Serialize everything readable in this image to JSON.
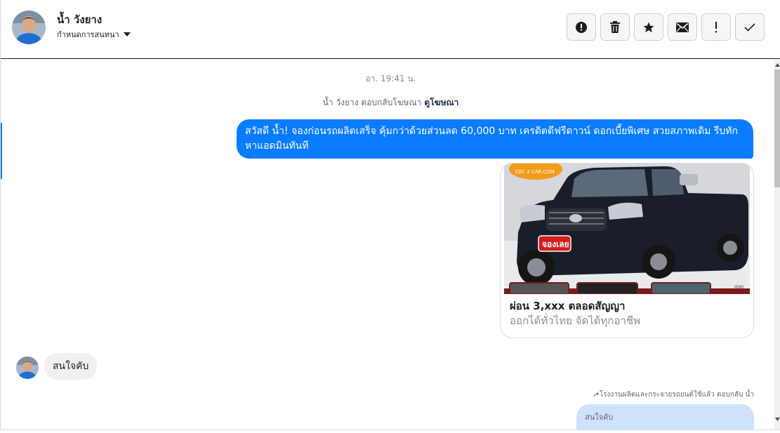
{
  "header": {
    "contact_name": "น้ำ วังยาง",
    "assign_label": "กำหนดการสนทนา",
    "actions": [
      "report",
      "delete",
      "star",
      "mail",
      "important",
      "done"
    ]
  },
  "thread": {
    "timestamp": "อา. 19:41 น.",
    "replied_text": "น้ำ วังยาง ตอบกลับโฆษณา",
    "replied_link": "ดูโฆษณา",
    "outgoing_message": "สวัสดี น้ำ! จองก่อนรถผลิตเสร็จ คุ้มกว่าด้วยส่วนลด 60,000 บาท เครดิตดีฟรีดาวน์ ดอกเบี้ยพิเศษ สวยสภาพเดิม รีบทักหาแอดมินทันที",
    "ad": {
      "logo_text": "CKC 2 CAR.COM",
      "badge_text": "จองเลย",
      "plate_text": "J090",
      "title": "ผ่อน 3,xxx ตลอดสัญญา",
      "subtitle": "ออกได้ทั่วไทย จัดได้ทุกอาชีพ"
    },
    "incoming_message": "สนใจคับ",
    "reply_meta": "โรงงานผลิตและกระจายรถยนต์ใช้แล้ว ตอบกลับ น้ำ",
    "quoted_reply": "สนใจคับ"
  },
  "colors": {
    "outgoing_bubble": "#0a7cff",
    "incoming_bubble": "#f0f0f0",
    "quoted_bubble": "#cfe2fb",
    "accent": "#1877f2"
  },
  "icons": [
    "alert-circle-icon",
    "trash-icon",
    "star-icon",
    "envelope-icon",
    "exclamation-icon",
    "check-icon",
    "chevron-down-icon",
    "reply-arrow-icon"
  ]
}
